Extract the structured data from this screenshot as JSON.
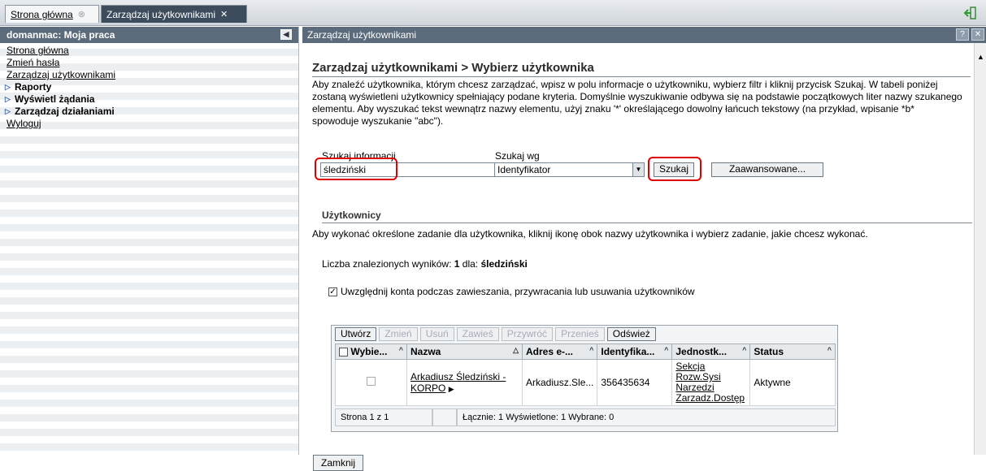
{
  "tabs": [
    {
      "label": "Strona główna",
      "close": "⊗"
    },
    {
      "label": "Zarządzaj użytkownikami",
      "close": "✕"
    }
  ],
  "left_panel": {
    "title": "domanmac: Moja praca",
    "links": [
      "Strona główna",
      "Zmień hasła",
      "Zarządzaj użytkownikami"
    ],
    "groups": [
      "Raporty",
      "Wyświetl żądania",
      "Zarządzaj działaniami"
    ],
    "logout": "Wyloguj"
  },
  "right_panel": {
    "title": "Zarządzaj użytkownikami",
    "help": "?",
    "close": "✕"
  },
  "page": {
    "heading": "Zarządzaj użytkownikami > Wybierz użytkownika",
    "description": "Aby znaleźć użytkownika, którym chcesz zarządzać, wpisz w polu informacje o użytkowniku, wybierz filtr i kliknij przycisk Szukaj. W tabeli poniżej zostaną wyświetleni użytkownicy spełniający podane kryteria. Domyślnie wyszukiwanie odbywa się na podstawie początkowych liter nazwy szukanego elementu. Aby wyszukać tekst wewnątrz nazwy elementu, użyj znaku '*' określającego dowolny łańcuch tekstowy (na przykład, wpisanie *b* spowoduje wyszukanie \"abc\").",
    "search_label": "Szukaj informacji",
    "search_value": "śledziński",
    "searchby_label": "Szukaj wg",
    "searchby_value": "Identyfikator",
    "search_button": "Szukaj",
    "advanced_button": "Zaawansowane...",
    "users_heading": "Użytkownicy",
    "users_text": "Aby wykonać określone zadanie dla użytkownika, kliknij ikonę obok nazwy użytkownika i wybierz zadanie, jakie chcesz wykonać.",
    "results_prefix": "Liczba znalezionych wyników:",
    "results_count": "1",
    "results_mid": "dla:",
    "results_query": "śledziński",
    "include_label": "Uwzględnij konta podczas zawieszania, przywracania lub usuwania użytkowników",
    "close_button": "Zamknij"
  },
  "grid": {
    "toolbar": [
      "Utwórz",
      "Zmień",
      "Usuń",
      "Zawieś",
      "Przywróć",
      "Przenieś",
      "Odśwież"
    ],
    "columns": [
      "Wybie...",
      "Nazwa",
      "Adres e-...",
      "Identyfika...",
      "Jednostk...",
      "Status"
    ],
    "row": {
      "name": "Arkadiusz Śledziński - KORPO",
      "email": "Arkadiusz.Sle...",
      "id": "356435634",
      "unit_lines": [
        "Sekcja",
        "Rozw.Sysi",
        "Narzedzi",
        "Zarzadz.Dostęp"
      ],
      "status": "Aktywne"
    },
    "footer": {
      "page": "Strona 1 z 1",
      "summary": "Łącznie: 1  Wyświetlone: 1  Wybrane: 0"
    }
  }
}
